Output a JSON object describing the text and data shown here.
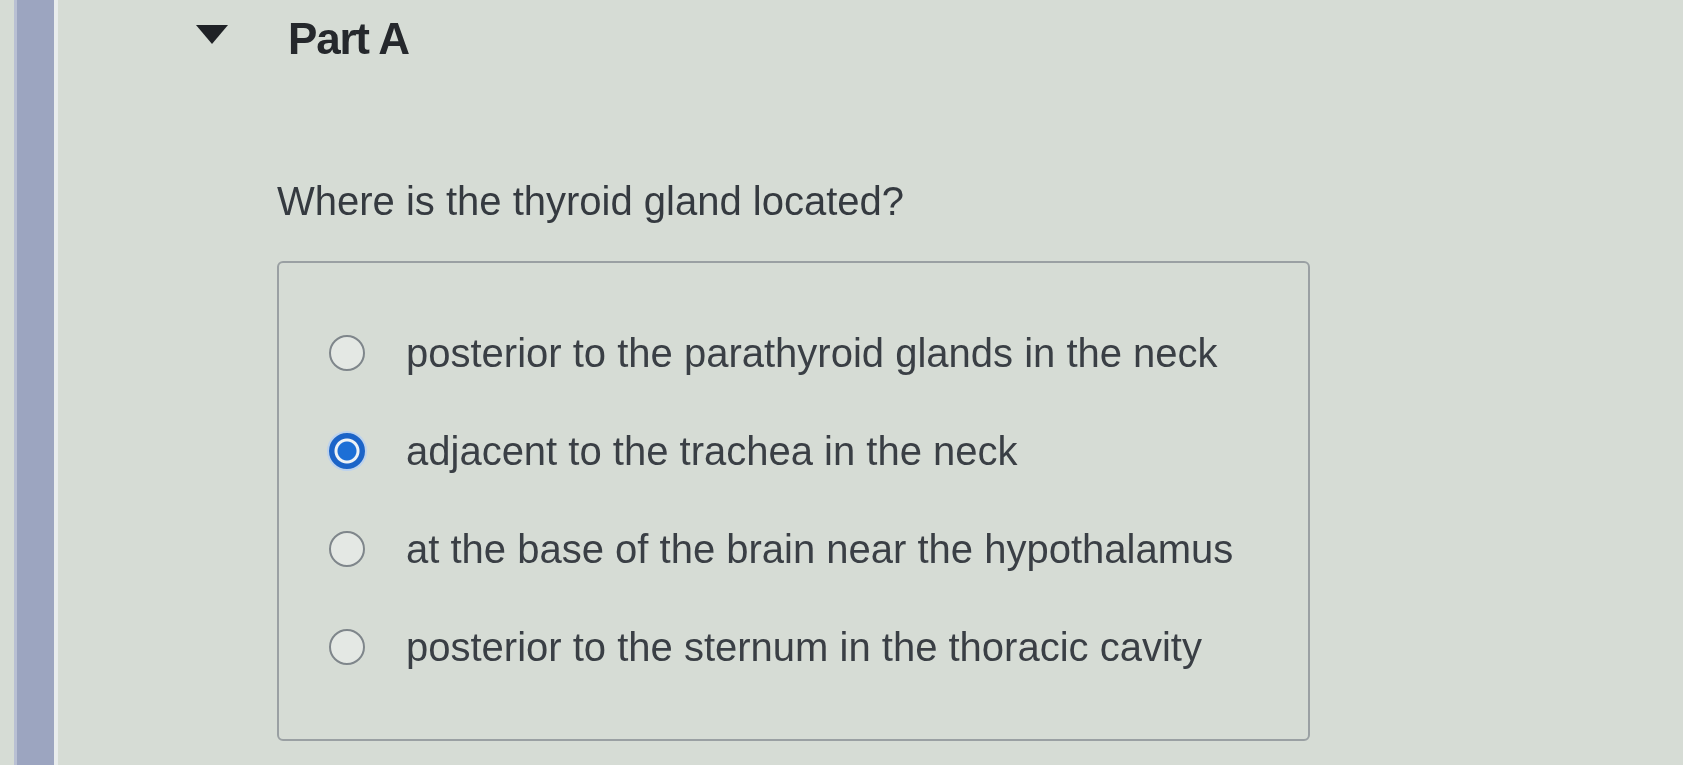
{
  "section": {
    "title": "Part A",
    "expanded": true
  },
  "question": "Where is the thyroid gland located?",
  "options": [
    {
      "label": "posterior to the parathyroid glands in the neck",
      "selected": false
    },
    {
      "label": "adjacent to the trachea in the neck",
      "selected": true
    },
    {
      "label": "at the base of the brain near the hypothalamus",
      "selected": false
    },
    {
      "label": "posterior to the sternum in the thoracic cavity",
      "selected": false
    }
  ]
}
